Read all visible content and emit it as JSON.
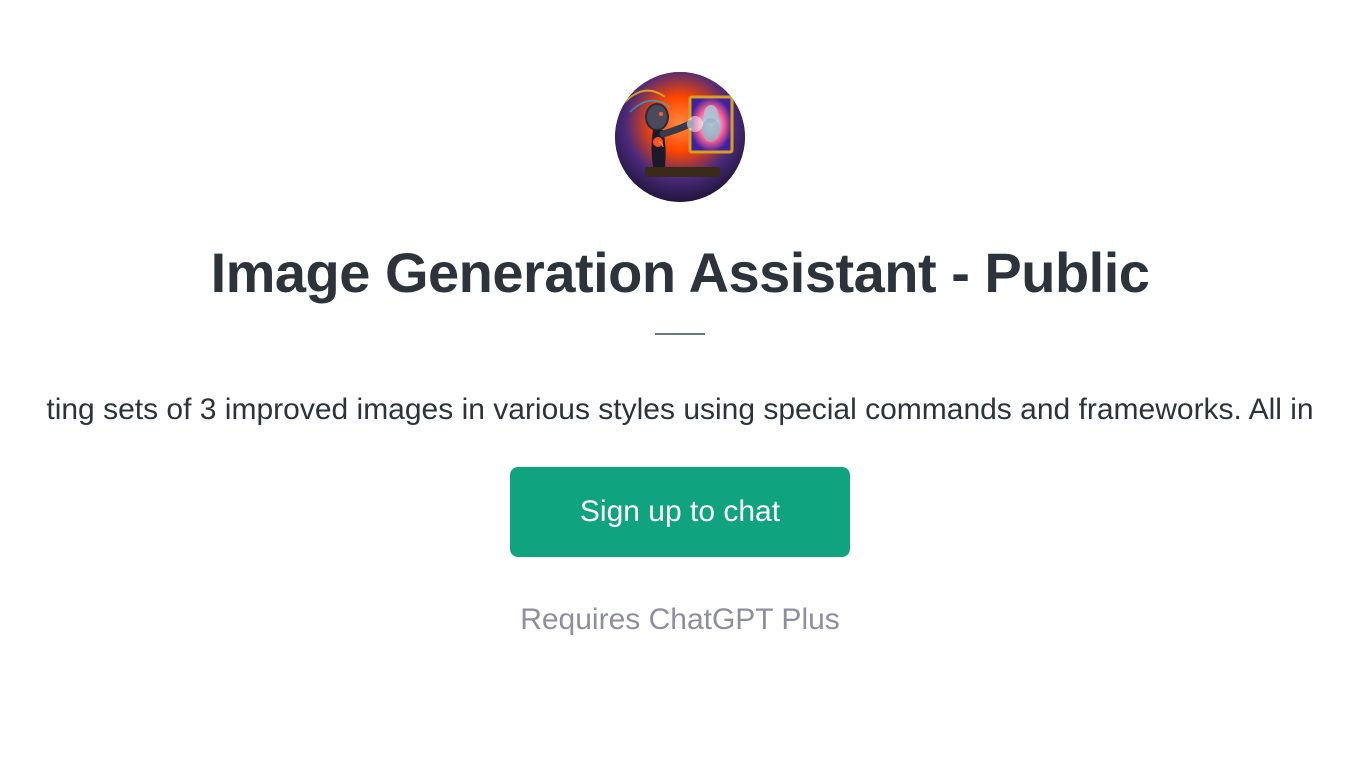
{
  "title": "Image Generation Assistant - Public",
  "description": "ting sets of 3 improved images in various styles using special commands and frameworks. All in",
  "cta_label": "Sign up to chat",
  "requires_text": "Requires ChatGPT Plus",
  "avatar_alt": "robot-painting-avatar"
}
